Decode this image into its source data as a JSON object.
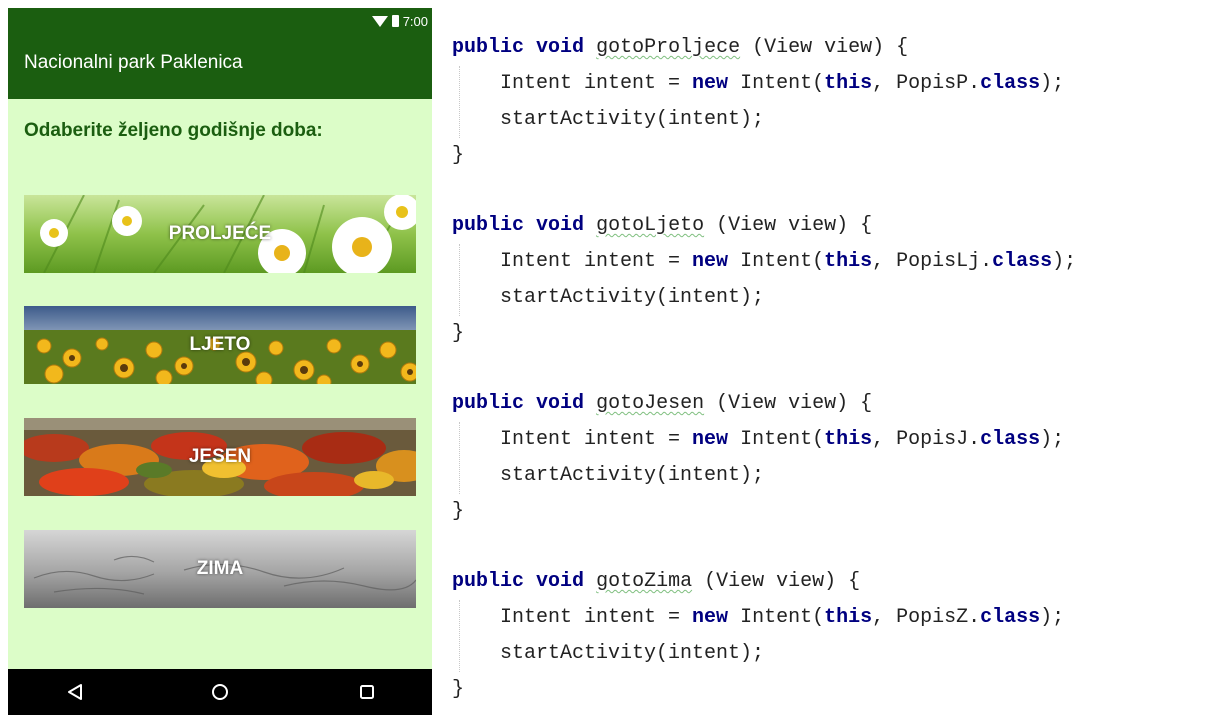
{
  "phone": {
    "status_time": "7:00",
    "app_title": "Nacionalni park Paklenica",
    "prompt": "Odaberite željeno godišnje doba:",
    "seasons": [
      {
        "label": "PROLJEĆE"
      },
      {
        "label": "LJETO"
      },
      {
        "label": "JESEN"
      },
      {
        "label": "ZIMA"
      }
    ],
    "nav": {
      "back_icon": "back-icon",
      "home_icon": "home-icon",
      "recents_icon": "recents-icon"
    }
  },
  "colors": {
    "app_bar": "#1b5e10",
    "background": "#dcfdc8",
    "keyword": "#000080"
  },
  "code": {
    "blocks": [
      {
        "kw1": "public",
        "kw2": "void",
        "method": "gotoProljece",
        "params": " (View view) {",
        "kw_new": "new",
        "intent_pre": "Intent intent = ",
        "intent_mid": " Intent(",
        "kw_this": "this",
        "intent_post": ", PopisP.",
        "kw_class": "class",
        "intent_end": ");",
        "start": "startActivity(intent);",
        "close": "}"
      },
      {
        "kw1": "public",
        "kw2": "void",
        "method": "gotoLjeto",
        "params": " (View view) {",
        "kw_new": "new",
        "intent_pre": "Intent intent = ",
        "intent_mid": " Intent(",
        "kw_this": "this",
        "intent_post": ", PopisLj.",
        "kw_class": "class",
        "intent_end": ");",
        "start": "startActivity(intent);",
        "close": "}"
      },
      {
        "kw1": "public",
        "kw2": "void",
        "method": "gotoJesen",
        "params": " (View view) {",
        "kw_new": "new",
        "intent_pre": "Intent intent = ",
        "intent_mid": " Intent(",
        "kw_this": "this",
        "intent_post": ", PopisJ.",
        "kw_class": "class",
        "intent_end": ");",
        "start": "startActivity(intent);",
        "close": "}"
      },
      {
        "kw1": "public",
        "kw2": "void",
        "method": "gotoZima",
        "params": " (View view) {",
        "kw_new": "new",
        "intent_pre": "Intent intent = ",
        "intent_mid": " Intent(",
        "kw_this": "this",
        "intent_post": ", PopisZ.",
        "kw_class": "class",
        "intent_end": ");",
        "start": "startActivity(intent);",
        "close": "}"
      }
    ]
  }
}
